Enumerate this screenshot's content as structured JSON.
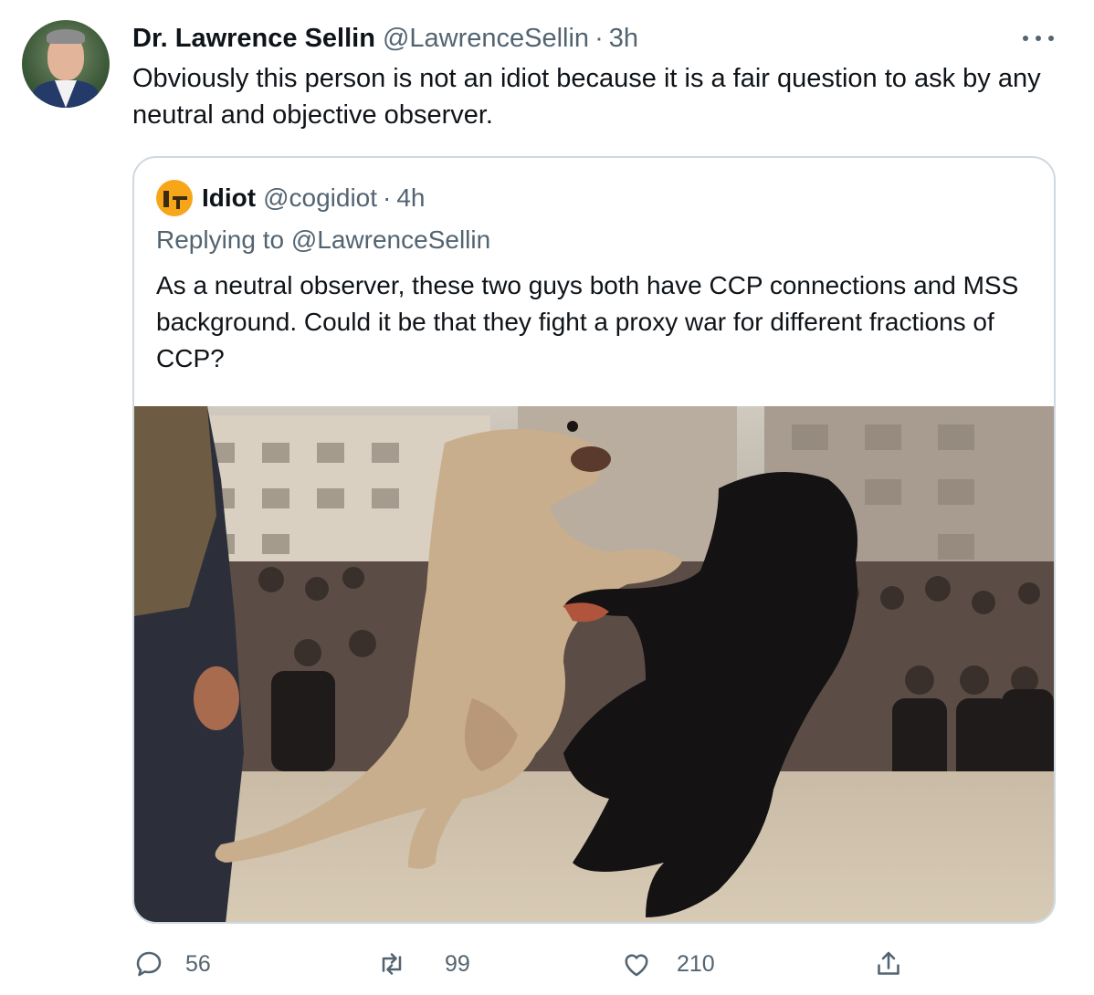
{
  "tweet": {
    "author_name": "Dr. Lawrence Sellin",
    "author_handle": "@LawrenceSellin",
    "separator": "·",
    "time": "3h",
    "text": "Obviously this person is not an idiot because it is a fair question to ask by any neutral and objective observer."
  },
  "quoted_tweet": {
    "author_name": "Idiot",
    "author_handle": "@cogidiot",
    "separator": "·",
    "time": "4h",
    "replying_to": "Replying to @LawrenceSellin",
    "text": "As a neutral observer, these two guys both have CCP connections and MSS background. Could it be that they fight a proxy war for different fractions of CCP?",
    "media": "photo-two-dogs-fighting-crowd"
  },
  "actions": {
    "replies": "56",
    "retweets": "99",
    "likes": "210"
  },
  "icons": {
    "more": "more-dots-icon",
    "reply": "reply-icon",
    "retweet": "retweet-icon",
    "like": "like-icon",
    "share": "share-icon"
  },
  "colors": {
    "secondary_text": "#536471",
    "border": "#cfd9de",
    "primary_text": "#0f1419"
  }
}
